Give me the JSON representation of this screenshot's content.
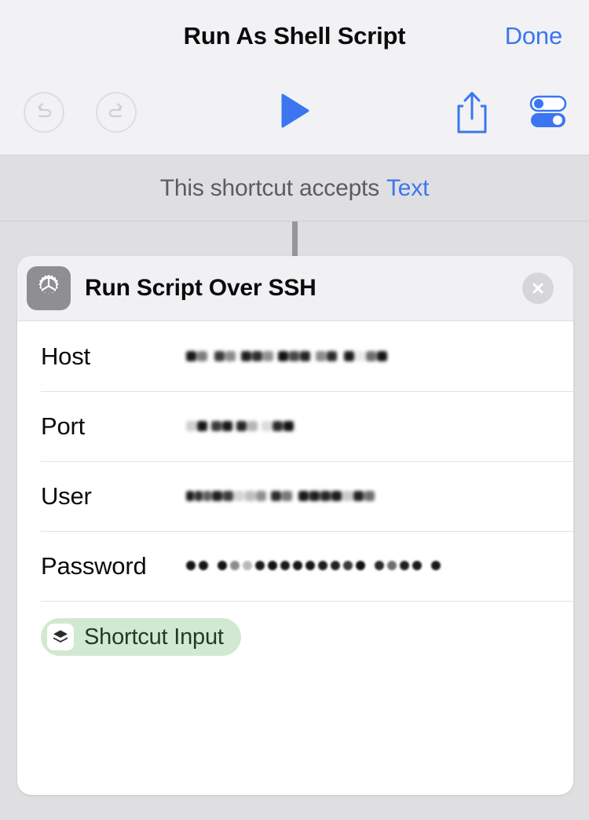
{
  "navbar": {
    "title": "Run As Shell Script",
    "done_label": "Done"
  },
  "toolbar": {
    "undo_icon": "undo-arrow-icon",
    "redo_icon": "redo-arrow-icon",
    "play_icon": "play-icon",
    "share_icon": "share-icon",
    "settings_icon": "settings-toggles-icon"
  },
  "accepts_bar": {
    "text": "This shortcut accepts",
    "type_link": "Text"
  },
  "action_card": {
    "icon": "gear-icon",
    "title": "Run Script Over SSH",
    "close_icon": "close-icon",
    "fields": [
      {
        "label": "Host",
        "value": "",
        "redacted": true,
        "blob_count": 16
      },
      {
        "label": "Port",
        "value": "",
        "redacted": true,
        "blob_count": 9
      },
      {
        "label": "User",
        "value": "",
        "redacted": true,
        "blob_count": 17
      },
      {
        "label": "Password",
        "value": "",
        "redacted": true,
        "masked": true,
        "dot_count": 21
      }
    ],
    "token": {
      "icon": "shortcut-input-layers-icon",
      "label": "Shortcut Input"
    }
  },
  "colors": {
    "accent_blue": "#3b76f0",
    "background_grey": "#dfdfe2",
    "navbar_grey": "#f2f2f5",
    "card_white": "#ffffff",
    "token_green_bg": "#d2e9d1",
    "token_green_text": "#1d3d21",
    "icon_grey": "#8e8e93",
    "connector_grey": "#95959b"
  }
}
